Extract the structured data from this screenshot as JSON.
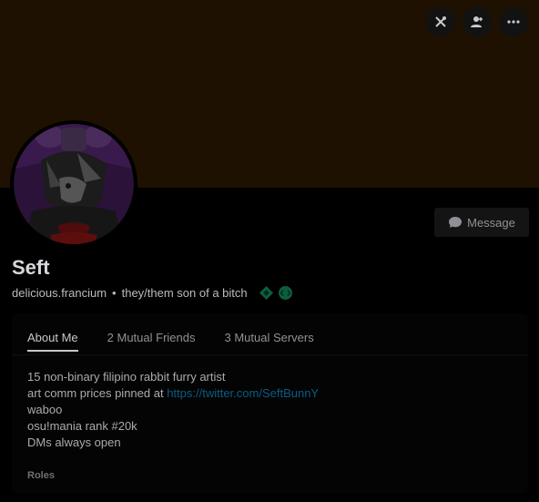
{
  "profile": {
    "display_name": "Seft",
    "username": "delicious.francium",
    "separator": "•",
    "pronouns": "they/them son of a bitch",
    "banner_color": "#1e1101",
    "accent_color": "#1e1101"
  },
  "header_actions": [
    {
      "icon": "close-badge-icon"
    },
    {
      "icon": "add-friend-icon"
    },
    {
      "icon": "more-options-icon"
    }
  ],
  "message_button": {
    "label": "Message",
    "icon": "chat-bubble-icon"
  },
  "badges": [
    {
      "icon": "hypesquad-diamond-icon",
      "color": "#0d5e3f"
    },
    {
      "icon": "active-developer-icon",
      "color": "#0d5e3f"
    }
  ],
  "tabs": [
    {
      "label": "About Me",
      "active": true
    },
    {
      "label": "2 Mutual Friends",
      "active": false
    },
    {
      "label": "3 Mutual Servers",
      "active": false
    }
  ],
  "about_me": {
    "line1": "15 non-binary filipino rabbit furry artist",
    "line2_prefix": "art comm prices pinned at ",
    "line2_link": "https://twitter.com/SeftBunnY",
    "line3": "waboo",
    "line4": "osu!mania rank #20k",
    "line5": "DMs always open"
  },
  "roles_label": "Roles"
}
